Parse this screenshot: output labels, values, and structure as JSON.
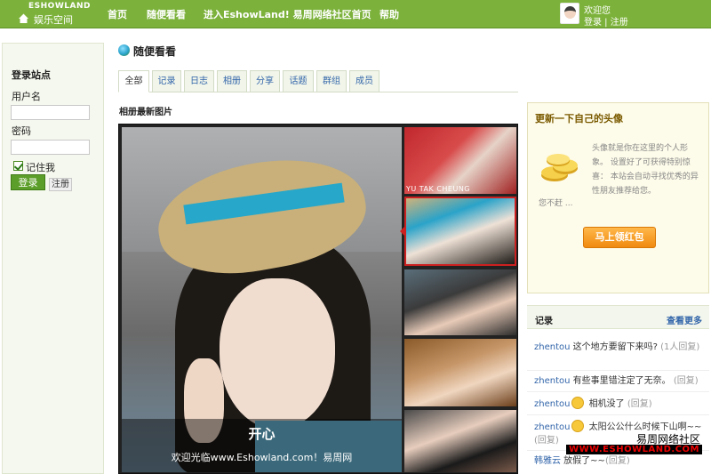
{
  "header": {
    "logo_en": "ESHOWLAND",
    "logo_cn": "娱乐空间",
    "nav": [
      "首页",
      "随便看看",
      "进入EshowLand! 易周网络社区首页",
      "帮助"
    ],
    "user_hello": "欢迎您",
    "user_login": "登录",
    "user_sep": " | ",
    "user_register": "注册"
  },
  "login": {
    "title": "登录站点",
    "username_label": "用户名",
    "password_label": "密码",
    "remember_label": "记住我",
    "login_button": "登录",
    "register_button": "注册",
    "remember_checked": true
  },
  "page": {
    "title": "随便看看",
    "tabs": [
      "全部",
      "记录",
      "日志",
      "相册",
      "分享",
      "话题",
      "群组",
      "成员"
    ],
    "active_tab": "全部",
    "section_title": "相册最新图片"
  },
  "viewer": {
    "caption_title": "开心",
    "caption_text": "欢迎光临www.Eshowland.com！易周网",
    "thumb_label_1": "YU TAK CHEUNG"
  },
  "avatar_panel": {
    "title": "更新一下自己的头像",
    "desc": "头像就是你在这里的个人形象。 设置好了可获得特别惊喜： 本站会自动寻找优秀的异性朋友推荐给您。",
    "desc2": "您不赶 ...",
    "button": "马上领红包"
  },
  "records": {
    "title": "记录",
    "more": "查看更多",
    "items": [
      {
        "user": "zhentou",
        "text": " 这个地方要留下来吗?",
        "reply": " (1人回复)"
      },
      {
        "user": "zhentou",
        "text": " 有些事里错注定了无奈。",
        "reply": " (回复)"
      },
      {
        "user": "zhentou",
        "text": " 相机没了",
        "reply": " (回复)"
      },
      {
        "user": "zhentou",
        "text": " 太阳公公什么时候下山啊~~",
        "reply": "(回复)"
      },
      {
        "user": "韩雅云",
        "text": " 放假了~~",
        "reply": "(回复)"
      }
    ]
  },
  "watermark": {
    "line1": "易周网络社区",
    "line2": "WWW.ESHOWLAND.COM"
  },
  "colors": {
    "topbar": "#7cb23b",
    "accent_orange": "#f08a10",
    "link_blue": "#3366aa"
  }
}
